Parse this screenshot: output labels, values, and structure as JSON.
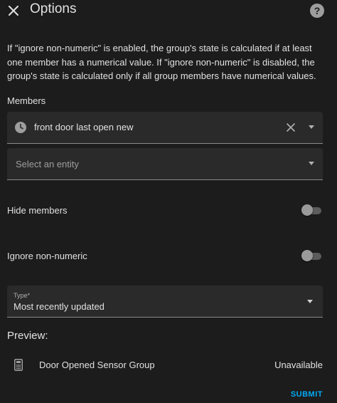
{
  "header": {
    "title": "Options",
    "help_label": "?"
  },
  "description": "If \"ignore non-numeric\" is enabled, the group's state is calculated if at least one member has a numerical value. If \"ignore non-numeric\" is disabled, the group's state is calculated only if all group members have numerical values.",
  "members": {
    "label": "Members",
    "items": [
      {
        "name": "front door last open new",
        "icon": "clock-icon"
      }
    ],
    "entity_placeholder": "Select an entity"
  },
  "toggles": {
    "hide_members": {
      "label": "Hide members",
      "checked": false
    },
    "ignore_non_numeric": {
      "label": "Ignore non-numeric",
      "checked": false
    }
  },
  "type": {
    "label": "Type*",
    "value": "Most recently updated"
  },
  "preview": {
    "heading": "Preview:",
    "entity_name": "Door Opened Sensor Group",
    "entity_state": "Unavailable",
    "icon": "calculator-icon"
  },
  "actions": {
    "submit_label": "SUBMIT"
  },
  "colors": {
    "background": "#1c1c1c",
    "field_background": "#2a2a2a",
    "accent": "#03a9f4",
    "text": "#e1e1e1"
  }
}
